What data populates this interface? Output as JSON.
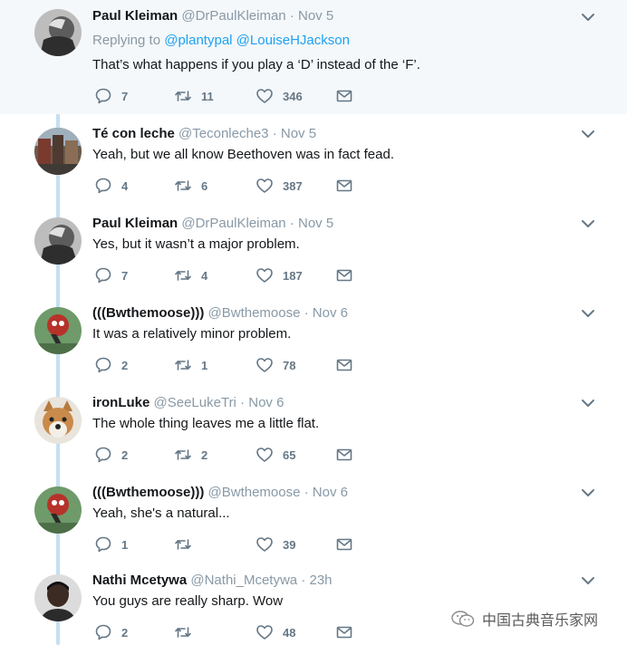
{
  "tweets": [
    {
      "name": "Paul Kleiman",
      "handle": "@DrPaulKleiman",
      "separator": "·",
      "time": "Nov 5",
      "replying_prefix": "Replying to",
      "replying_to": [
        "@plantypal",
        "@LouiseHJackson"
      ],
      "text": "That’s what happens if you play a ‘D’ instead of the ‘F’.",
      "replies": "7",
      "retweets": "11",
      "likes": "346",
      "avatar": "bw-man-avatar"
    },
    {
      "name": "Té con leche",
      "handle": "@Teconleche3",
      "separator": "·",
      "time": "Nov 5",
      "text": "Yeah, but we all know Beethoven was in fact fead.",
      "replies": "4",
      "retweets": "6",
      "likes": "387",
      "avatar": "street-scene-avatar"
    },
    {
      "name": "Paul Kleiman",
      "handle": "@DrPaulKleiman",
      "separator": "·",
      "time": "Nov 5",
      "text": "Yes, but it wasn’t a major problem.",
      "replies": "7",
      "retweets": "4",
      "likes": "187",
      "avatar": "bw-man-avatar"
    },
    {
      "name": "(((Bwthemoose)))",
      "handle": "@Bwthemoose",
      "separator": "·",
      "time": "Nov 6",
      "text": "It was a relatively minor problem.",
      "replies": "2",
      "retweets": "1",
      "likes": "78",
      "avatar": "cartoon-avatar"
    },
    {
      "name": "ironLuke",
      "handle": "@SeeLukeTri",
      "separator": "·",
      "time": "Nov 6",
      "text": "The whole thing leaves me a little flat.",
      "replies": "2",
      "retweets": "2",
      "likes": "65",
      "avatar": "dog-avatar"
    },
    {
      "name": "(((Bwthemoose)))",
      "handle": "@Bwthemoose",
      "separator": "·",
      "time": "Nov 6",
      "text": "Yeah, she's a natural...",
      "replies": "1",
      "retweets": "",
      "likes": "39",
      "avatar": "cartoon-avatar"
    },
    {
      "name": "Nathi Mcetywa",
      "handle": "@Nathi_Mcetywa",
      "separator": "·",
      "time": "23h",
      "text": "You guys are really sharp. Wow",
      "replies": "2",
      "retweets": "",
      "likes": "48",
      "avatar": "portrait-avatar"
    }
  ],
  "icons": {
    "reply": "reply-icon",
    "retweet": "retweet-icon",
    "like": "heart-icon",
    "dm": "envelope-icon",
    "more": "chevron-down-icon"
  },
  "colors": {
    "accent": "#1da1f2",
    "muted": "#8899a6",
    "thread_line": "#c4dff3",
    "highlight_bg": "#f5f8fa"
  },
  "watermark": {
    "text": "中国古典音乐家网"
  }
}
